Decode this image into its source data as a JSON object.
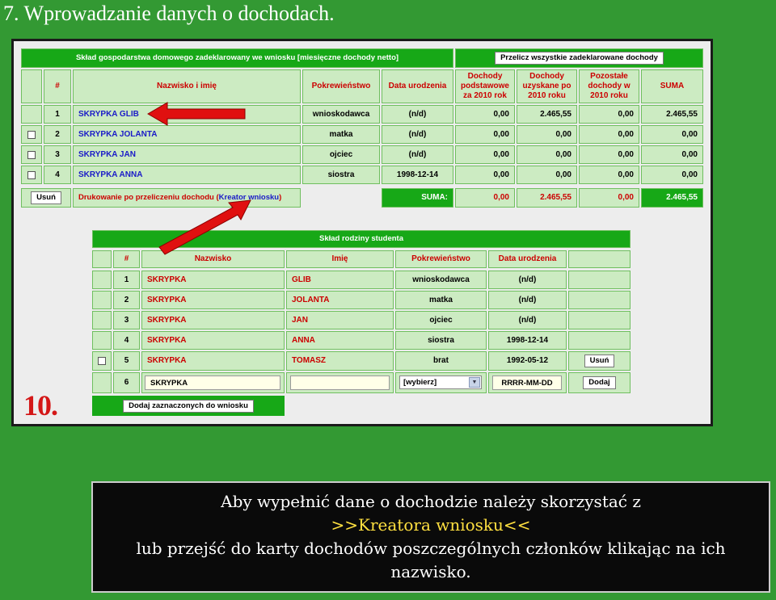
{
  "slide": {
    "title": "7. Wprowadzanie danych o dochodach."
  },
  "household": {
    "header": "Skład gospodarstwa domowego zadeklarowany we wniosku [miesięczne dochody netto]",
    "recalc_button": "Przelicz wszystkie zadeklarowane dochody",
    "columns": [
      "#",
      "Nazwisko i imię",
      "Pokrewieństwo",
      "Data urodzenia",
      "Dochody podstawowe za 2010 rok",
      "Dochody uzyskane po 2010 roku",
      "Pozostałe dochody w 2010 roku",
      "SUMA"
    ],
    "rows": [
      {
        "num": "1",
        "name": "SKRYPKA GLIB",
        "relation": "wnioskodawca",
        "birth": "(n/d)",
        "basic": "0,00",
        "after": "2.465,55",
        "other": "0,00",
        "sum": "2.465,55"
      },
      {
        "num": "2",
        "name": "SKRYPKA JOLANTA",
        "relation": "matka",
        "birth": "(n/d)",
        "basic": "0,00",
        "after": "0,00",
        "other": "0,00",
        "sum": "0,00"
      },
      {
        "num": "3",
        "name": "SKRYPKA JAN",
        "relation": "ojciec",
        "birth": "(n/d)",
        "basic": "0,00",
        "after": "0,00",
        "other": "0,00",
        "sum": "0,00"
      },
      {
        "num": "4",
        "name": "SKRYPKA ANNA",
        "relation": "siostra",
        "birth": "1998-12-14",
        "basic": "0,00",
        "after": "0,00",
        "other": "0,00",
        "sum": "0,00"
      }
    ],
    "delete_button": "Usuń",
    "print_text": "Drukowanie po przeliczeniu dochodu (",
    "wizard_link": "Kreator wniosku",
    "print_text_end": ")",
    "totals": {
      "label": "SUMA:",
      "basic": "0,00",
      "after": "2.465,55",
      "other": "0,00",
      "sum": "2.465,55"
    }
  },
  "family": {
    "header": "Skład rodziny studenta",
    "columns": [
      "#",
      "Nazwisko",
      "Imię",
      "Pokrewieństwo",
      "Data urodzenia"
    ],
    "rows": [
      {
        "num": "1",
        "surname": "SKRYPKA",
        "name": "GLIB",
        "relation": "wnioskodawca",
        "birth": "(n/d)"
      },
      {
        "num": "2",
        "surname": "SKRYPKA",
        "name": "JOLANTA",
        "relation": "matka",
        "birth": "(n/d)"
      },
      {
        "num": "3",
        "surname": "SKRYPKA",
        "name": "JAN",
        "relation": "ojciec",
        "birth": "(n/d)"
      },
      {
        "num": "4",
        "surname": "SKRYPKA",
        "name": "ANNA",
        "relation": "siostra",
        "birth": "1998-12-14"
      },
      {
        "num": "5",
        "surname": "SKRYPKA",
        "name": "TOMASZ",
        "relation": "brat",
        "birth": "1992-05-12",
        "button": "Usuń"
      }
    ],
    "new_row": {
      "num": "6",
      "surname_value": "SKRYPKA",
      "name_value": "",
      "relation_value": "[wybierz]",
      "birth_value": "RRRR-MM-DD",
      "add_button": "Dodaj"
    },
    "add_selected_button": "Dodaj zaznaczonych do wniosku"
  },
  "step_number": "10.",
  "info": {
    "line1": "Aby wypełnić dane o dochodzie należy skorzystać z",
    "line2": ">>Kreatora wniosku<<",
    "line3": "lub przejść do karty dochodów poszczególnych członków klikając na ich",
    "line4": "nazwisko."
  },
  "colors": {
    "background": "#339933",
    "header_green": "#17a817",
    "cell": "#ccebc2",
    "arrow": "#e01010",
    "accent": "#ffe040"
  }
}
